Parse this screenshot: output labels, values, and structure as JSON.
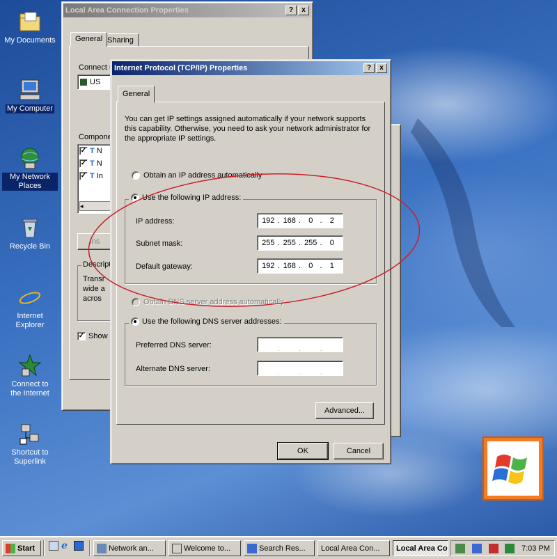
{
  "desktop": {
    "icons": [
      {
        "label": "My Documents",
        "icon": "folder-icon"
      },
      {
        "label": "My Computer",
        "icon": "computer-icon"
      },
      {
        "label": "My Network Places",
        "icon": "network-icon"
      },
      {
        "label": "Recycle Bin",
        "icon": "recycle-bin-icon"
      },
      {
        "label": "Internet Explorer",
        "icon": "internet-explorer-icon"
      },
      {
        "label": "Connect to the Internet",
        "icon": "connect-wizard-icon"
      },
      {
        "label": "Shortcut to Superlink",
        "icon": "shortcut-icon"
      }
    ]
  },
  "lan_window": {
    "title": "Local Area Connection Properties",
    "tabs": [
      "General",
      "Sharing"
    ],
    "connect_label": "Connect u",
    "adapter_text": "US",
    "components_label": "Compone",
    "components": [
      "N",
      "N",
      "In"
    ],
    "install_button": "Ins",
    "description_label": "Descript",
    "description_lines": [
      "Transr",
      "wide a",
      "acros"
    ],
    "show_label": "Show",
    "help_button": "?",
    "close_button": "x"
  },
  "tcpip_window": {
    "title": "Internet Protocol (TCP/IP) Properties",
    "tab": "General",
    "help_button": "?",
    "close_button": "x",
    "description": "You can get IP settings assigned automatically if your network supports this capability. Otherwise, you need to ask your network administrator for the appropriate IP settings.",
    "obtain_ip_auto": "Obtain an IP address automatically",
    "use_following_ip": "Use the following IP address:",
    "ip_address_label": "IP address:",
    "ip_address": [
      "192",
      "168",
      "0",
      "2"
    ],
    "subnet_mask_label": "Subnet mask:",
    "subnet_mask": [
      "255",
      "255",
      "255",
      "0"
    ],
    "default_gateway_label": "Default gateway:",
    "default_gateway": [
      "192",
      "168",
      "0",
      "1"
    ],
    "obtain_dns_auto": "Obtain DNS server address automatically",
    "use_following_dns": "Use the following DNS server addresses:",
    "preferred_dns_label": "Preferred DNS server:",
    "alternate_dns_label": "Alternate DNS server:",
    "advanced_button": "Advanced...",
    "ok_button": "OK",
    "cancel_button": "Cancel"
  },
  "taskbar": {
    "start": "Start",
    "buttons": [
      "Network an...",
      "Welcome to...",
      "Search Res...",
      "Local Area Con...",
      "Local Area Co..."
    ],
    "clock": "7:03 PM"
  },
  "colors": {
    "highlight": "#0a246a",
    "annotation_ellipse": "#c8202a"
  }
}
